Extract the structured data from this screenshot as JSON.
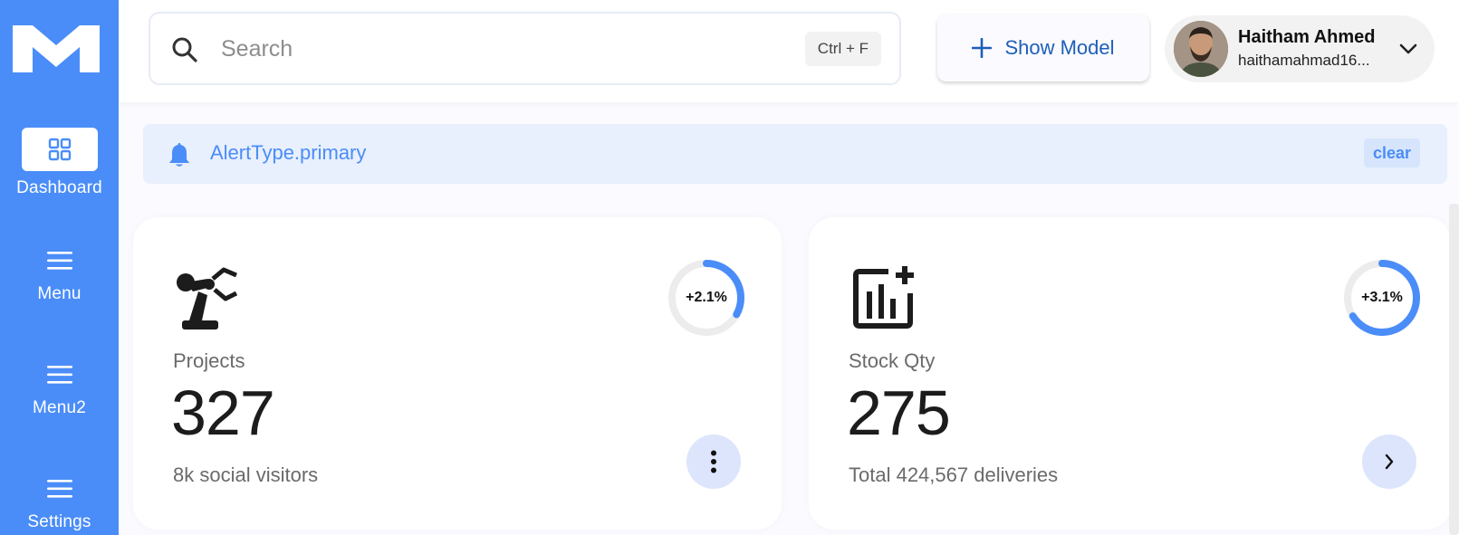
{
  "sidebar": {
    "items": [
      {
        "label": "Dashboard",
        "icon": "grid-icon",
        "active": true
      },
      {
        "label": "Menu",
        "icon": "hamburger-icon"
      },
      {
        "label": "Menu2",
        "icon": "hamburger-icon"
      },
      {
        "label": "Settings",
        "icon": "hamburger-icon"
      }
    ]
  },
  "header": {
    "search": {
      "placeholder": "Search",
      "shortcut": "Ctrl + F"
    },
    "show_model_label": "Show Model",
    "user": {
      "name": "Haitham Ahmed",
      "email": "haithamahmad16..."
    }
  },
  "alert": {
    "text": "AlertType.primary",
    "clear_label": "clear"
  },
  "cards": [
    {
      "label": "Projects",
      "value": "327",
      "sub": "8k social visitors",
      "change": "+2.1%",
      "ring_fraction": 0.33,
      "icon": "robot-arm-icon",
      "action_icon": "more-vertical-icon"
    },
    {
      "label": "Stock Qty",
      "value": "275",
      "sub": "Total 424,567 deliveries",
      "change": "+3.1%",
      "ring_fraction": 0.66,
      "icon": "chart-add-icon",
      "action_icon": "chevron-right-icon"
    }
  ],
  "colors": {
    "primary": "#4a8df8",
    "ring_track": "#ececec",
    "action_bg": "#dce5fb"
  }
}
